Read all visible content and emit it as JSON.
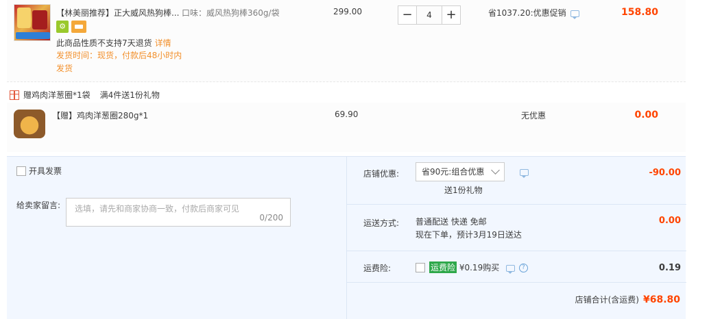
{
  "product": {
    "title": "【林美丽推荐】正大威风热狗棒...",
    "attr": "口味：威风热狗棒360g/袋",
    "notice": "此商品性质不支持7天退货",
    "notice_link": "详情",
    "ship_time": "发货时间：现货，付款后48小时内发货",
    "price": "299.00",
    "qty": "4",
    "qty_minus": "−",
    "qty_plus": "+",
    "save": "省1037.20:优惠促销",
    "subtotal": "158.80"
  },
  "gift_header": {
    "label": "赠鸡肉洋葱圈*1袋",
    "condition": "满4件送1份礼物"
  },
  "gift": {
    "title": "【赠】鸡肉洋葱圈280g*1",
    "price": "69.90",
    "discount": "无优惠",
    "total": "0.00"
  },
  "panel": {
    "invoice_label": "开具发票",
    "message_label": "给卖家留言:",
    "message_placeholder": "选填，请先和商家协商一致，付款后商家可见",
    "message_count": "0/200",
    "shop_discount_label": "店铺优惠:",
    "shop_discount_selected": "省90元:组合优惠",
    "shop_discount_gift": "送1份礼物",
    "shop_discount_value": "-90.00",
    "shipping_label": "运送方式:",
    "shipping_method": "普通配送 快递 免邮",
    "shipping_eta": "现在下单，预计3月19日送达",
    "shipping_value": "0.00",
    "insurance_label": "运费险:",
    "insurance_tag": "运费险",
    "insurance_price": "¥0.19购买",
    "insurance_value": "0.19",
    "total_label": "店铺合计(含运费)",
    "total_value": "¥68.80"
  }
}
